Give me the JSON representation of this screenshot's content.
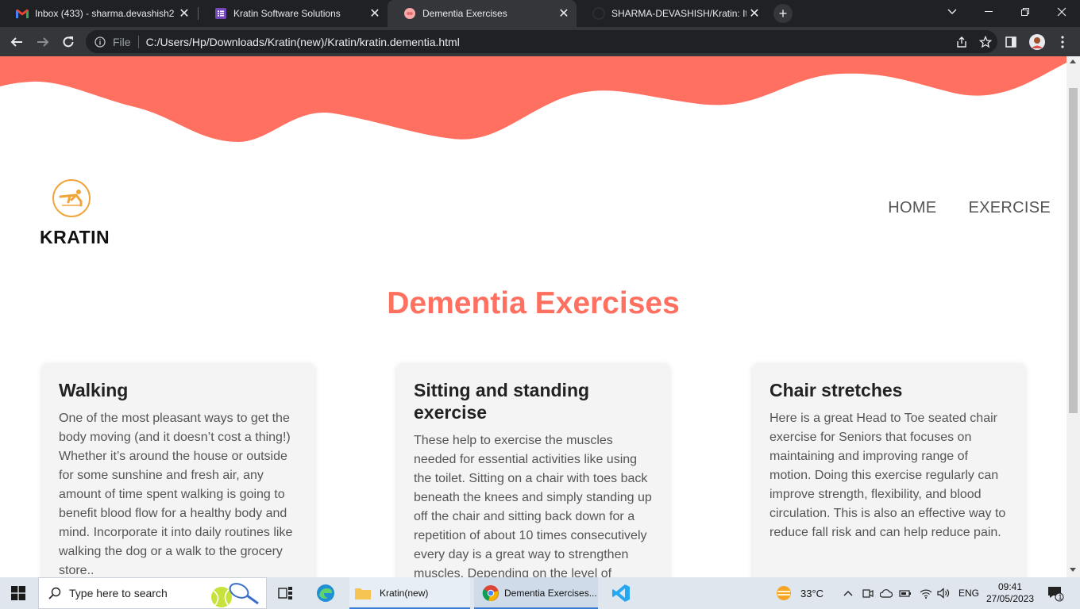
{
  "browser": {
    "tabs": [
      {
        "title": "Inbox (433) - sharma.devashish2",
        "icon": "gmail-icon"
      },
      {
        "title": "Kratin Software Solutions",
        "icon": "form-icon"
      },
      {
        "title": "Dementia Exercises",
        "icon": "brain-icon",
        "active": true
      },
      {
        "title": "SHARMA-DEVASHISH/Kratin: It is",
        "icon": "github-icon"
      }
    ],
    "url_scheme_label": "File",
    "url": "C:/Users/Hp/Downloads/Kratin(new)/Kratin/kratin.dementia.html"
  },
  "site": {
    "brand": "KRATIN",
    "nav": [
      "HOME",
      "EXERCISE"
    ],
    "title": "Dementia Exercises",
    "accent_color": "#ff7060",
    "cards": [
      {
        "title": "Walking",
        "text": "One of the most pleasant ways to get the body moving (and it doesn’t cost a thing!) Whether it’s around the house or outside for some sunshine and fresh air, any amount of time spent walking is going to benefit blood flow for a healthy body and mind. Incorporate it into daily routines like walking the dog or a walk to the grocery store.."
      },
      {
        "title": "Sitting and standing exercise",
        "text": "These help to exercise the muscles needed for essential activities like using the toilet. Sitting on a chair with toes back beneath the knees and simply standing up off the chair and sitting back down for a repetition of about 10 times consecutively every day is a great way to strengthen muscles. Depending on the level of"
      },
      {
        "title": "Chair stretches",
        "text": "Here is a great Head to Toe seated chair exercise for Seniors that focuses on maintaining and improving range of motion. Doing this exercise regularly can improve strength, flexibility, and blood circulation. This is also an effective way to reduce fall risk and can help reduce pain."
      }
    ]
  },
  "taskbar": {
    "search_placeholder": "Type here to search",
    "apps": [
      "Kratin(new)",
      "Dementia Exercises..."
    ],
    "weather": "33°C",
    "language": "ENG",
    "time": "09:41",
    "date": "27/05/2023",
    "notification_count": "1"
  }
}
